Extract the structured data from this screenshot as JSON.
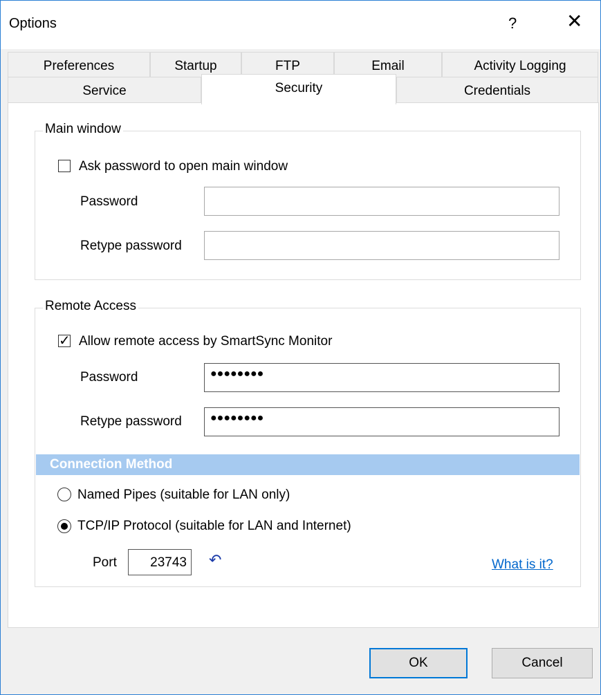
{
  "window": {
    "title": "Options",
    "help_glyph": "?",
    "close_glyph": "✕"
  },
  "tabs": {
    "row1": [
      "Preferences",
      "Startup",
      "FTP",
      "Email",
      "Activity Logging"
    ],
    "row2": [
      "Service",
      "Security",
      "Credentials"
    ],
    "active": "Security"
  },
  "main_window": {
    "group_label": "Main window",
    "ask_password_label": "Ask password to open main window",
    "ask_password_checked": false,
    "password_label": "Password",
    "password_value": "",
    "retype_label": "Retype password",
    "retype_value": ""
  },
  "remote_access": {
    "group_label": "Remote Access",
    "allow_label": "Allow remote access by SmartSync Monitor",
    "allow_checked": true,
    "password_label": "Password",
    "password_value": "●●●●●●●●",
    "retype_label": "Retype password",
    "retype_value": "●●●●●●●●",
    "connection_method_title": "Connection Method",
    "named_pipes_label": "Named Pipes (suitable for LAN only)",
    "tcpip_label": "TCP/IP Protocol (suitable for LAN and Internet)",
    "selected_method": "tcpip",
    "port_label": "Port",
    "port_value": "23743",
    "reset_icon": "undo-arrow-icon",
    "help_link": "What is it?"
  },
  "buttons": {
    "ok": "OK",
    "cancel": "Cancel"
  },
  "colors": {
    "section_bar": "#a6caf0",
    "link": "#0066cc",
    "accent": "#0078d7"
  }
}
